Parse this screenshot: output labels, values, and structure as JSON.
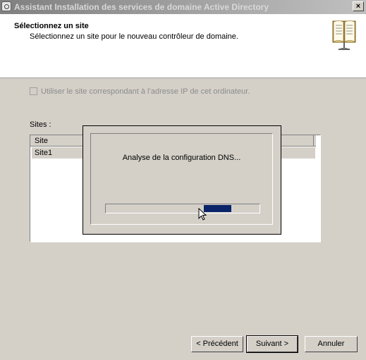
{
  "window": {
    "title": "Assistant Installation des services de domaine Active Directory",
    "close_label": "×"
  },
  "header": {
    "title": "Sélectionnez un site",
    "subtitle": "Sélectionnez un site pour le nouveau contrôleur de domaine."
  },
  "checkbox": {
    "label": "Utiliser le site correspondant à l’adresse IP de cet ordinateur.",
    "checked": false,
    "enabled": false
  },
  "sites": {
    "label": "Sites :",
    "columns": [
      "Site"
    ],
    "rows": [
      {
        "site": "Site1"
      }
    ]
  },
  "progress": {
    "message": "Analyse de la configuration DNS...",
    "marquee_position": 0.77
  },
  "buttons": {
    "back": "< Précédent",
    "next": "Suivant >",
    "cancel": "Annuler"
  },
  "colors": {
    "titlebar_start": "#808080",
    "progress_chunk": "#0a246a",
    "window_bg": "#d4d0c8"
  }
}
